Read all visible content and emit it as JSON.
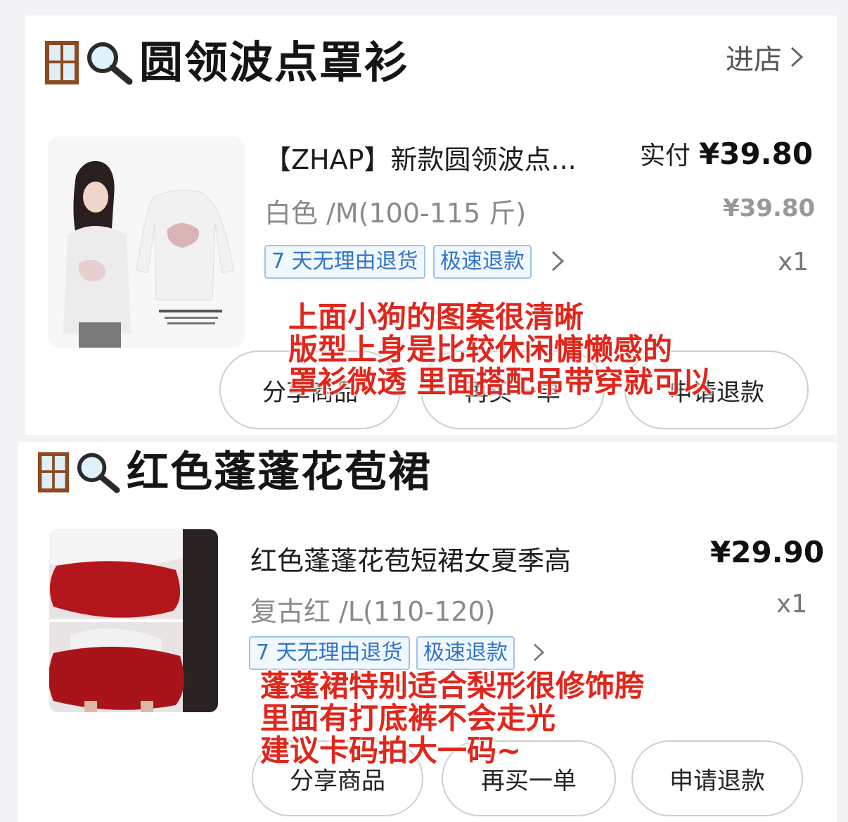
{
  "order1": {
    "heading": "圆领波点罩衫",
    "store_link": "进店",
    "title": "【ZHAP】新款圆领波点...",
    "paid_label": "实付",
    "paid_price": "¥39.80",
    "variant": "白色 /M(100-115 斤)",
    "unit_price": "¥39.80",
    "tags": [
      "7 天无理由退货",
      "极速退款"
    ],
    "qty": "x1",
    "note": [
      "上面小狗的图案很清晰",
      "版型上身是比较休闲慵懒感的",
      "罩衫微透 里面搭配吊带穿就可以"
    ],
    "buttons": [
      "分享商品",
      "再买一单",
      "申请退款"
    ]
  },
  "order2": {
    "heading": "红色蓬蓬花苞裙",
    "title": "红色蓬蓬花苞短裙女夏季高",
    "price": "¥29.90",
    "variant": "复古红 /L(110-120)",
    "qty": "x1",
    "tags": [
      "7 天无理由退货",
      "极速退款"
    ],
    "note": [
      "蓬蓬裙特别适合梨形很修饰胯",
      "里面有打底裤不会走光",
      "建议卡码拍大一码~"
    ],
    "buttons": [
      "分享商品",
      "再买一单",
      "申请退款"
    ]
  },
  "colors": {
    "note_red": "#e1261c",
    "tag_blue": "#2f75cc",
    "tag_border": "#9ec3ee"
  },
  "icons": [
    "window-icon",
    "magnifier-icon",
    "chevron-right-icon"
  ]
}
